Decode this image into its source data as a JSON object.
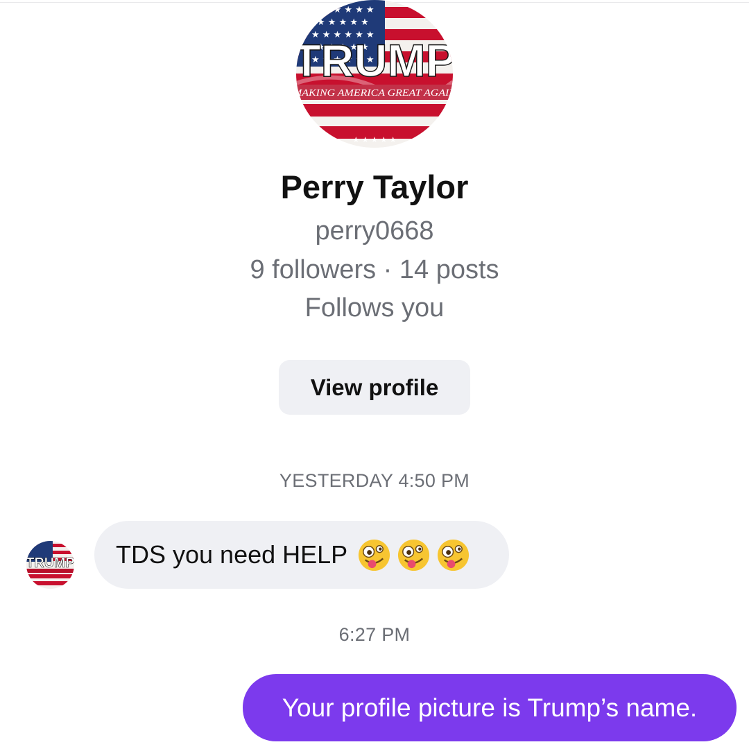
{
  "profile": {
    "name": "Perry Taylor",
    "handle": "perry0668",
    "stats": "9 followers · 14 posts",
    "follows_status": "Follows you",
    "avatar": {
      "icon": "trump-flag-avatar",
      "banner_text": "TRUMP",
      "tagline": "MAKING AMERICA GREAT AGAIN"
    },
    "view_profile_label": "View profile"
  },
  "thread": {
    "timestamp_1": "YESTERDAY 4:50 PM",
    "incoming_message": {
      "text": "TDS you need HELP",
      "emoji_icon": "zany-face-emoji",
      "emoji_count": 3
    },
    "timestamp_2": "6:27 PM",
    "outgoing_message": {
      "text": "Your profile picture is Trump’s name."
    }
  },
  "colors": {
    "outgoing_bubble": "#7c3aed",
    "incoming_bubble": "#eff0f4",
    "secondary_text": "#6b6e75",
    "flag_red": "#c8102e",
    "flag_blue": "#1f3a78"
  }
}
